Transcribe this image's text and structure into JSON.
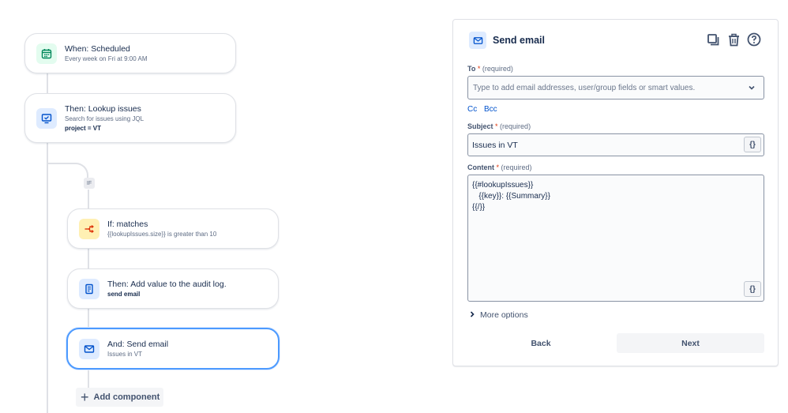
{
  "flow": {
    "trigger": {
      "title": "When: Scheduled",
      "subtitle": "Every week on Fri at 9:00 AM"
    },
    "lookup": {
      "title": "Then: Lookup issues",
      "subtitle": "Search for issues using JQL",
      "detail": "project = VT"
    },
    "branch_label": "IF",
    "condition": {
      "title": "If: matches",
      "subtitle": "{{lookupIssues.size}} is greater than 10"
    },
    "audit": {
      "title": "Then: Add value to the audit log.",
      "detail": "send email"
    },
    "send": {
      "title": "And: Send email",
      "subtitle": "Issues in VT"
    },
    "add_component": "Add component"
  },
  "panel": {
    "title": "Send email",
    "to_label": "To",
    "to_required": "(required)",
    "to_placeholder": "Type to add email addresses, user/group fields or smart values.",
    "cc": "Cc",
    "bcc": "Bcc",
    "subject_label": "Subject",
    "subject_required": "(required)",
    "subject_value": "Issues in VT",
    "content_label": "Content",
    "content_required": "(required)",
    "content_value": "{{#lookupIssues}}\n   {{key}}: {{Summary}}\n{{/}}",
    "smart_value_button": "{}",
    "more_options": "More options",
    "back": "Back",
    "next": "Next"
  },
  "icons": {
    "trigger": "calendar-icon",
    "lookup": "monitor-check-icon",
    "condition": "branch-icon",
    "audit": "document-icon",
    "send": "mail-icon"
  },
  "colors": {
    "accent": "#0052cc",
    "selected_border": "#4c9aff",
    "required": "#de350b"
  }
}
